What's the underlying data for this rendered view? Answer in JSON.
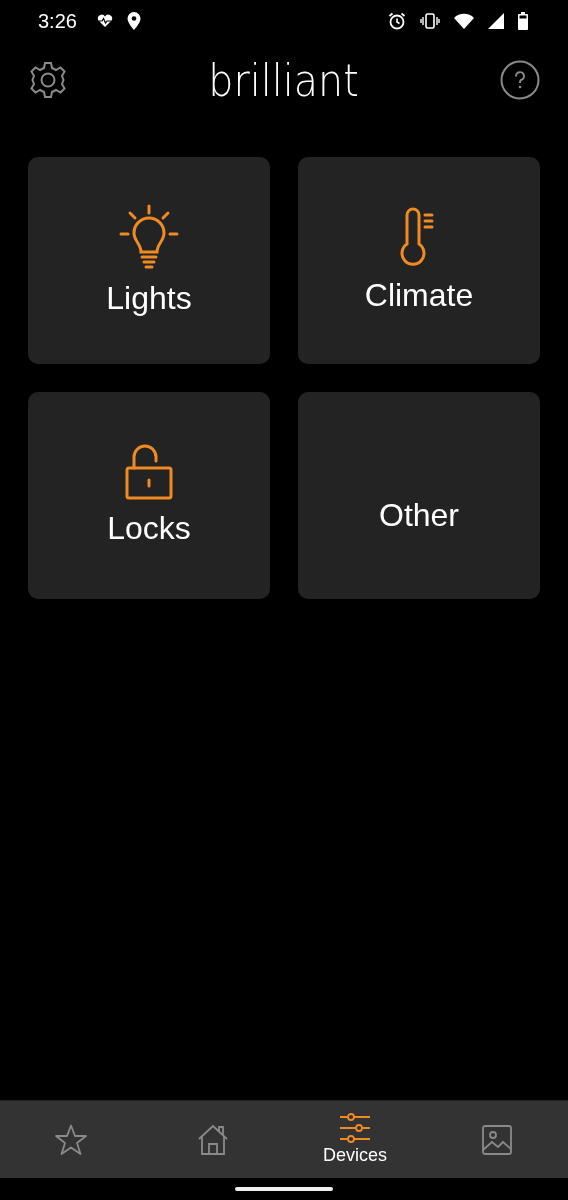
{
  "status_bar": {
    "time": "3:26"
  },
  "header": {
    "logo": "brilliant"
  },
  "tiles": [
    {
      "label": "Lights",
      "kind": "bulb"
    },
    {
      "label": "Climate",
      "kind": "thermometer"
    },
    {
      "label": "Locks",
      "kind": "lock"
    },
    {
      "label": "Other",
      "kind": "none"
    }
  ],
  "nav": [
    {
      "kind": "star",
      "selected": false
    },
    {
      "kind": "home",
      "selected": false
    },
    {
      "kind": "devices",
      "label": "Devices",
      "selected": true
    },
    {
      "kind": "image",
      "selected": false
    }
  ]
}
